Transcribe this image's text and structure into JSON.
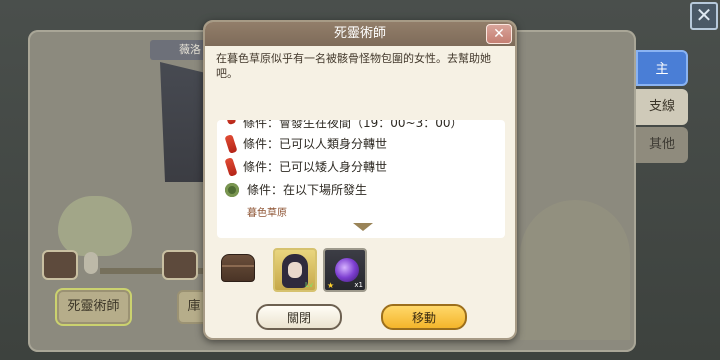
{
  "screen": {
    "map_title": "薇洛",
    "nodes": [
      "死靈術師",
      "庫"
    ],
    "close_glyph": "✕"
  },
  "side_tabs": [
    {
      "label": "主",
      "active": true
    },
    {
      "label": "支線",
      "active": false
    },
    {
      "label": "其他",
      "active": false
    }
  ],
  "dialog": {
    "title": "死靈術師",
    "close_glyph": "✕",
    "description": "在暮色草原似乎有一名被骸骨怪物包圍的女性。去幫助她吧。",
    "conditions": [
      {
        "icon": "red-potion-icon",
        "text": "條件：會發生在夜間（19：00~3：00）"
      },
      {
        "icon": "red-potion-icon",
        "text": "條件：已可以人類身分轉世"
      },
      {
        "icon": "red-potion-icon",
        "text": "條件：已可以矮人身分轉世"
      },
      {
        "icon": "leaf-map-icon",
        "text": "條件：在以下場所發生"
      }
    ],
    "location": "暮色草原",
    "rewards": {
      "card1_level": "Lv",
      "card2_star": "★",
      "card2_count": "x1"
    },
    "buttons": {
      "close": "關閉",
      "move": "移動"
    }
  },
  "colors": {
    "header_bg": "#8a7764",
    "dialog_bg": "#f6f1e4",
    "active_tab": "#4a7ed6",
    "move_button": "#f4b52b",
    "location_text": "#8e5434"
  }
}
